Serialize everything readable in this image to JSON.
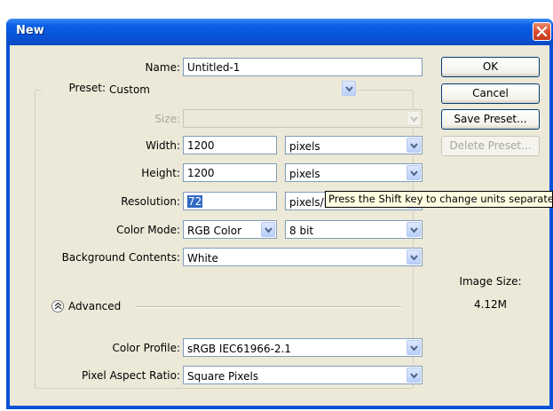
{
  "window": {
    "title": "New"
  },
  "form": {
    "name_label": "Name:",
    "name_value": "Untitled-1",
    "preset_label": "Preset:",
    "preset_value": "Custom",
    "size_label": "Size:",
    "width_label": "Width:",
    "width_value": "1200",
    "width_unit": "pixels",
    "height_label": "Height:",
    "height_value": "1200",
    "height_unit": "pixels",
    "resolution_label": "Resolution:",
    "resolution_value": "72",
    "resolution_unit": "pixels/inch",
    "color_mode_label": "Color Mode:",
    "color_mode_value": "RGB Color",
    "bit_depth_value": "8 bit",
    "background_label": "Background Contents:",
    "background_value": "White",
    "advanced_label": "Advanced",
    "color_profile_label": "Color Profile:",
    "color_profile_value": "sRGB IEC61966-2.1",
    "pixel_aspect_label": "Pixel Aspect Ratio:",
    "pixel_aspect_value": "Square Pixels"
  },
  "buttons": {
    "ok": "OK",
    "cancel": "Cancel",
    "save_preset": "Save Preset...",
    "delete_preset": "Delete Preset..."
  },
  "image_size": {
    "label": "Image Size:",
    "value": "4.12M"
  },
  "tooltip": "Press the Shift key to change units separately",
  "icons": {
    "close": "close-icon",
    "dropdown": "chevron-down-icon",
    "advanced": "collapse-up-icon"
  },
  "colors": {
    "titlebar": "#0a52d8",
    "dialog_bg": "#ece9d8",
    "selection": "#316ac5",
    "tooltip_bg": "#ffffe1"
  }
}
